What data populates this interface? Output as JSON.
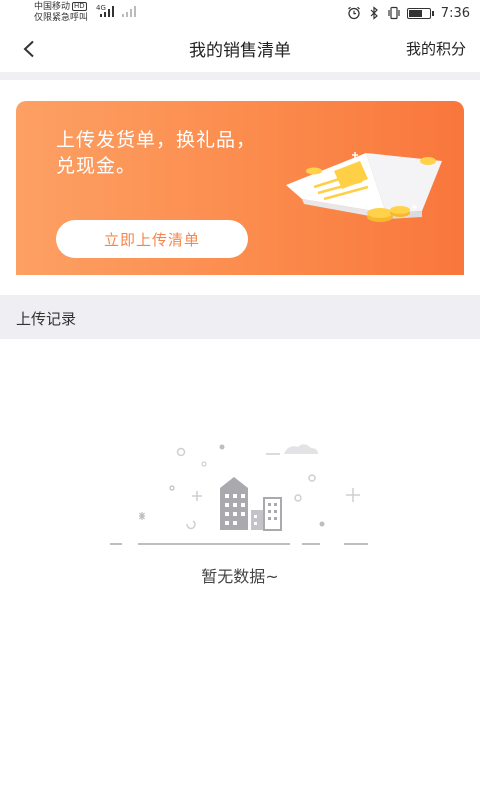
{
  "status_bar": {
    "carrier_line1": "中国移动",
    "carrier_badge": "HD",
    "carrier_line2": "仅限紧急呼叫",
    "network": "4G",
    "time": "7:36",
    "battery_level": 0.7,
    "icons": [
      "alarm-icon",
      "bluetooth-icon",
      "vibrate-icon",
      "battery-icon"
    ]
  },
  "navbar": {
    "title": "我的销售清单",
    "right_link": "我的积分",
    "back_icon": "chevron-left-icon"
  },
  "banner": {
    "line1": "上传发货单，换礼品，",
    "line2": "兑现金。",
    "button_label": "立即上传清单",
    "gradient_colors": [
      "#fda064",
      "#f9763c"
    ],
    "button_text_color": "#f7864b"
  },
  "section": {
    "title": "上传记录"
  },
  "empty_state": {
    "message": "暂无数据~",
    "icon": "empty-city-icon"
  }
}
